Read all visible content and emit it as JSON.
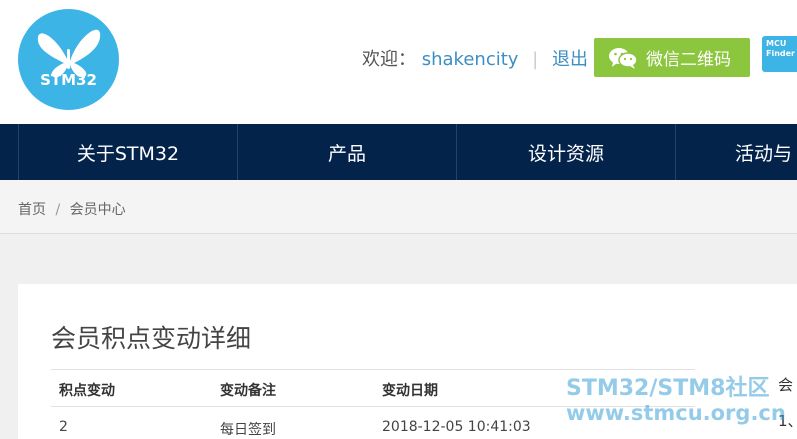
{
  "header": {
    "logo_text": "STM32",
    "welcome_label": "欢迎：",
    "username": "shakencity",
    "separator": "|",
    "logout_label": "退出",
    "wechat_button_label": "微信二维码",
    "mcu_finder_line1": "MCU",
    "mcu_finder_line2": "Finder",
    "accent_color": "#3cb4e6",
    "wechat_color": "#8cc63e"
  },
  "nav": {
    "background_color": "#03234b",
    "items": [
      {
        "label": "关于STM32"
      },
      {
        "label": "产品"
      },
      {
        "label": "设计资源"
      },
      {
        "label": "活动与"
      }
    ]
  },
  "breadcrumb": {
    "home": "首页",
    "separator": "/",
    "current": "会员中心"
  },
  "main": {
    "title": "会员积点变动详细",
    "table": {
      "headers": [
        "积点变动",
        "变动备注",
        "变动日期"
      ],
      "rows": [
        [
          "2",
          "每日签到",
          "2018-12-05 10:41:03"
        ]
      ]
    },
    "side_fragments": [
      "会",
      "1、"
    ]
  },
  "watermark": {
    "line1": "STM32/STM8社区",
    "line2": "www.stmcu.org.cn"
  }
}
